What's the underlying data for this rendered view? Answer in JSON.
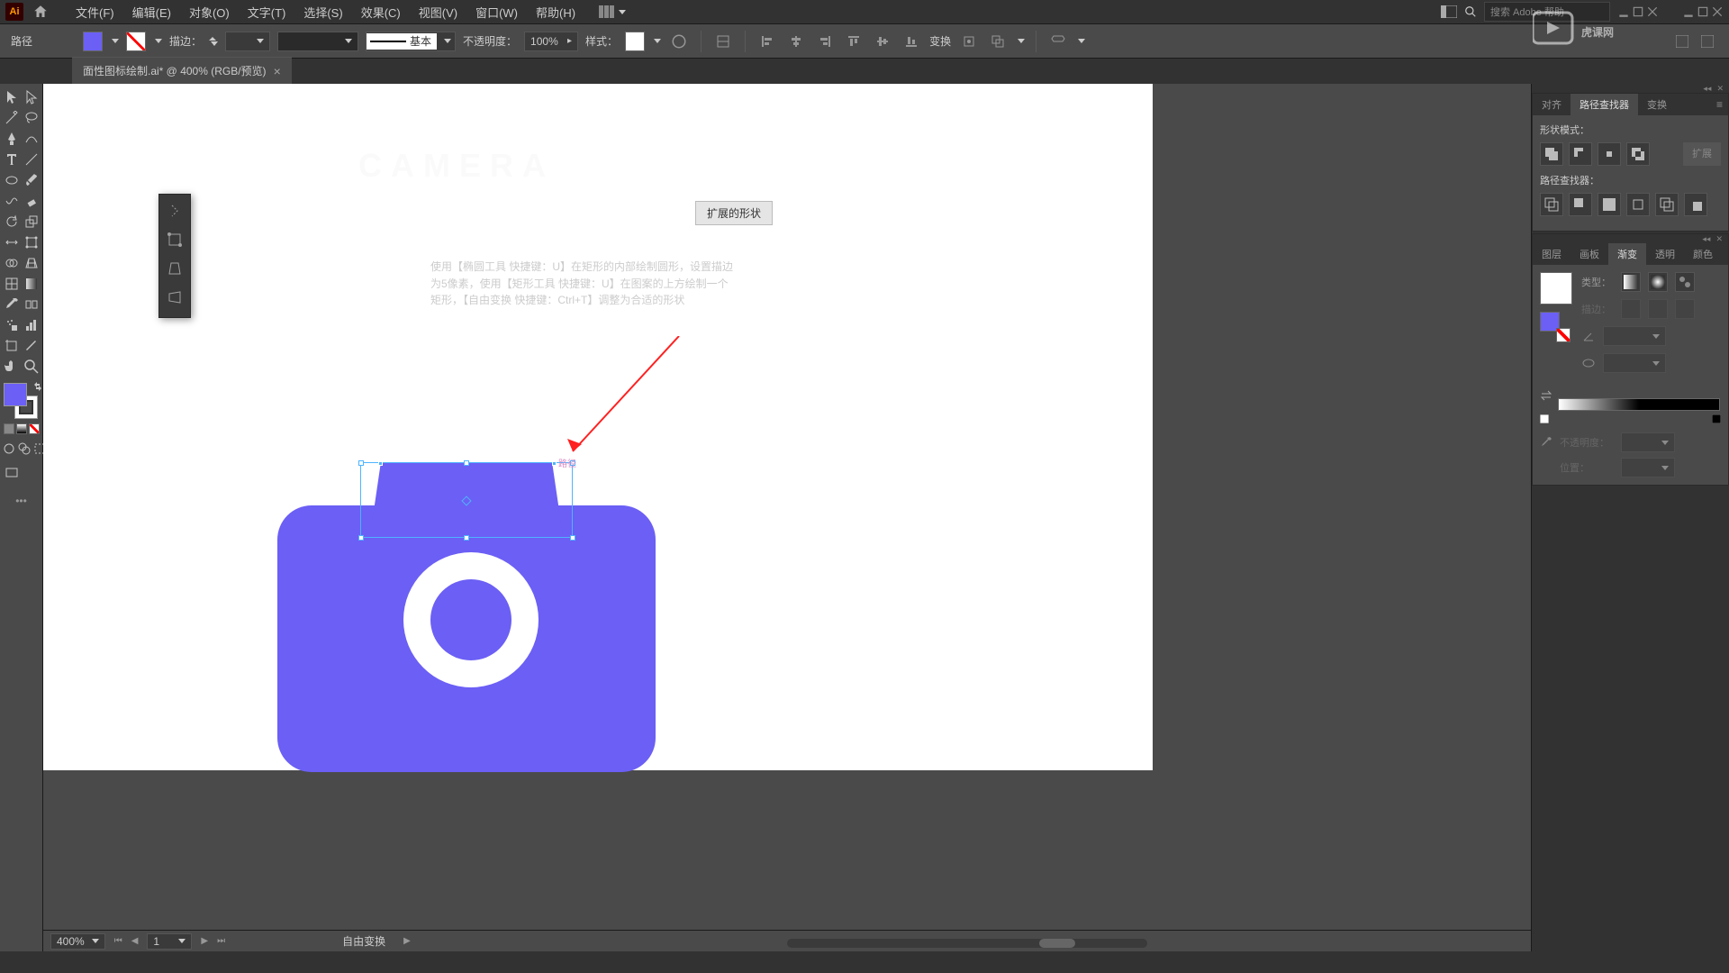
{
  "menubar": {
    "items": [
      "文件(F)",
      "编辑(E)",
      "对象(O)",
      "文字(T)",
      "选择(S)",
      "效果(C)",
      "视图(V)",
      "窗口(W)",
      "帮助(H)"
    ],
    "search_placeholder": "搜索 Adobe 帮助"
  },
  "controlbar": {
    "selection_label": "路径",
    "stroke_label": "描边：",
    "profile_label": "基本",
    "opacity_label": "不透明度：",
    "opacity_value": "100%",
    "style_label": "样式：",
    "transform_label": "变换"
  },
  "document": {
    "tab_title": "面性图标绘制.ai* @ 400% (RGB/预览)"
  },
  "canvas": {
    "header_text": "CAMERA",
    "shape_chip": "扩展的形状",
    "path_label": "路径",
    "annotation_line1": "使用【椭圆工具 快捷键：U】在矩形的内部绘制圆形，设置描边",
    "annotation_line2": "为5像素，使用【矩形工具 快捷键：U】在图案的上方绘制一个",
    "annotation_line3": "矩形，【自由变换 快捷键：Ctrl+T】调整为合适的形状"
  },
  "panels": {
    "align_tabs": [
      "对齐",
      "路径查找器",
      "变换"
    ],
    "shape_mode_label": "形状模式：",
    "pathfinder_label": "路径查找器：",
    "expand_label": "扩展",
    "grad_tabs": [
      "图层",
      "画板",
      "渐变",
      "透明",
      "颜色"
    ],
    "type_label": "类型：",
    "grad_stroke_label": "描边：",
    "opacity_label": "不透明度：",
    "position_label": "位置："
  },
  "statusbar": {
    "zoom": "400%",
    "artboard_num": "1",
    "tool_hint": "自由变换"
  },
  "watermark": "虎课网"
}
